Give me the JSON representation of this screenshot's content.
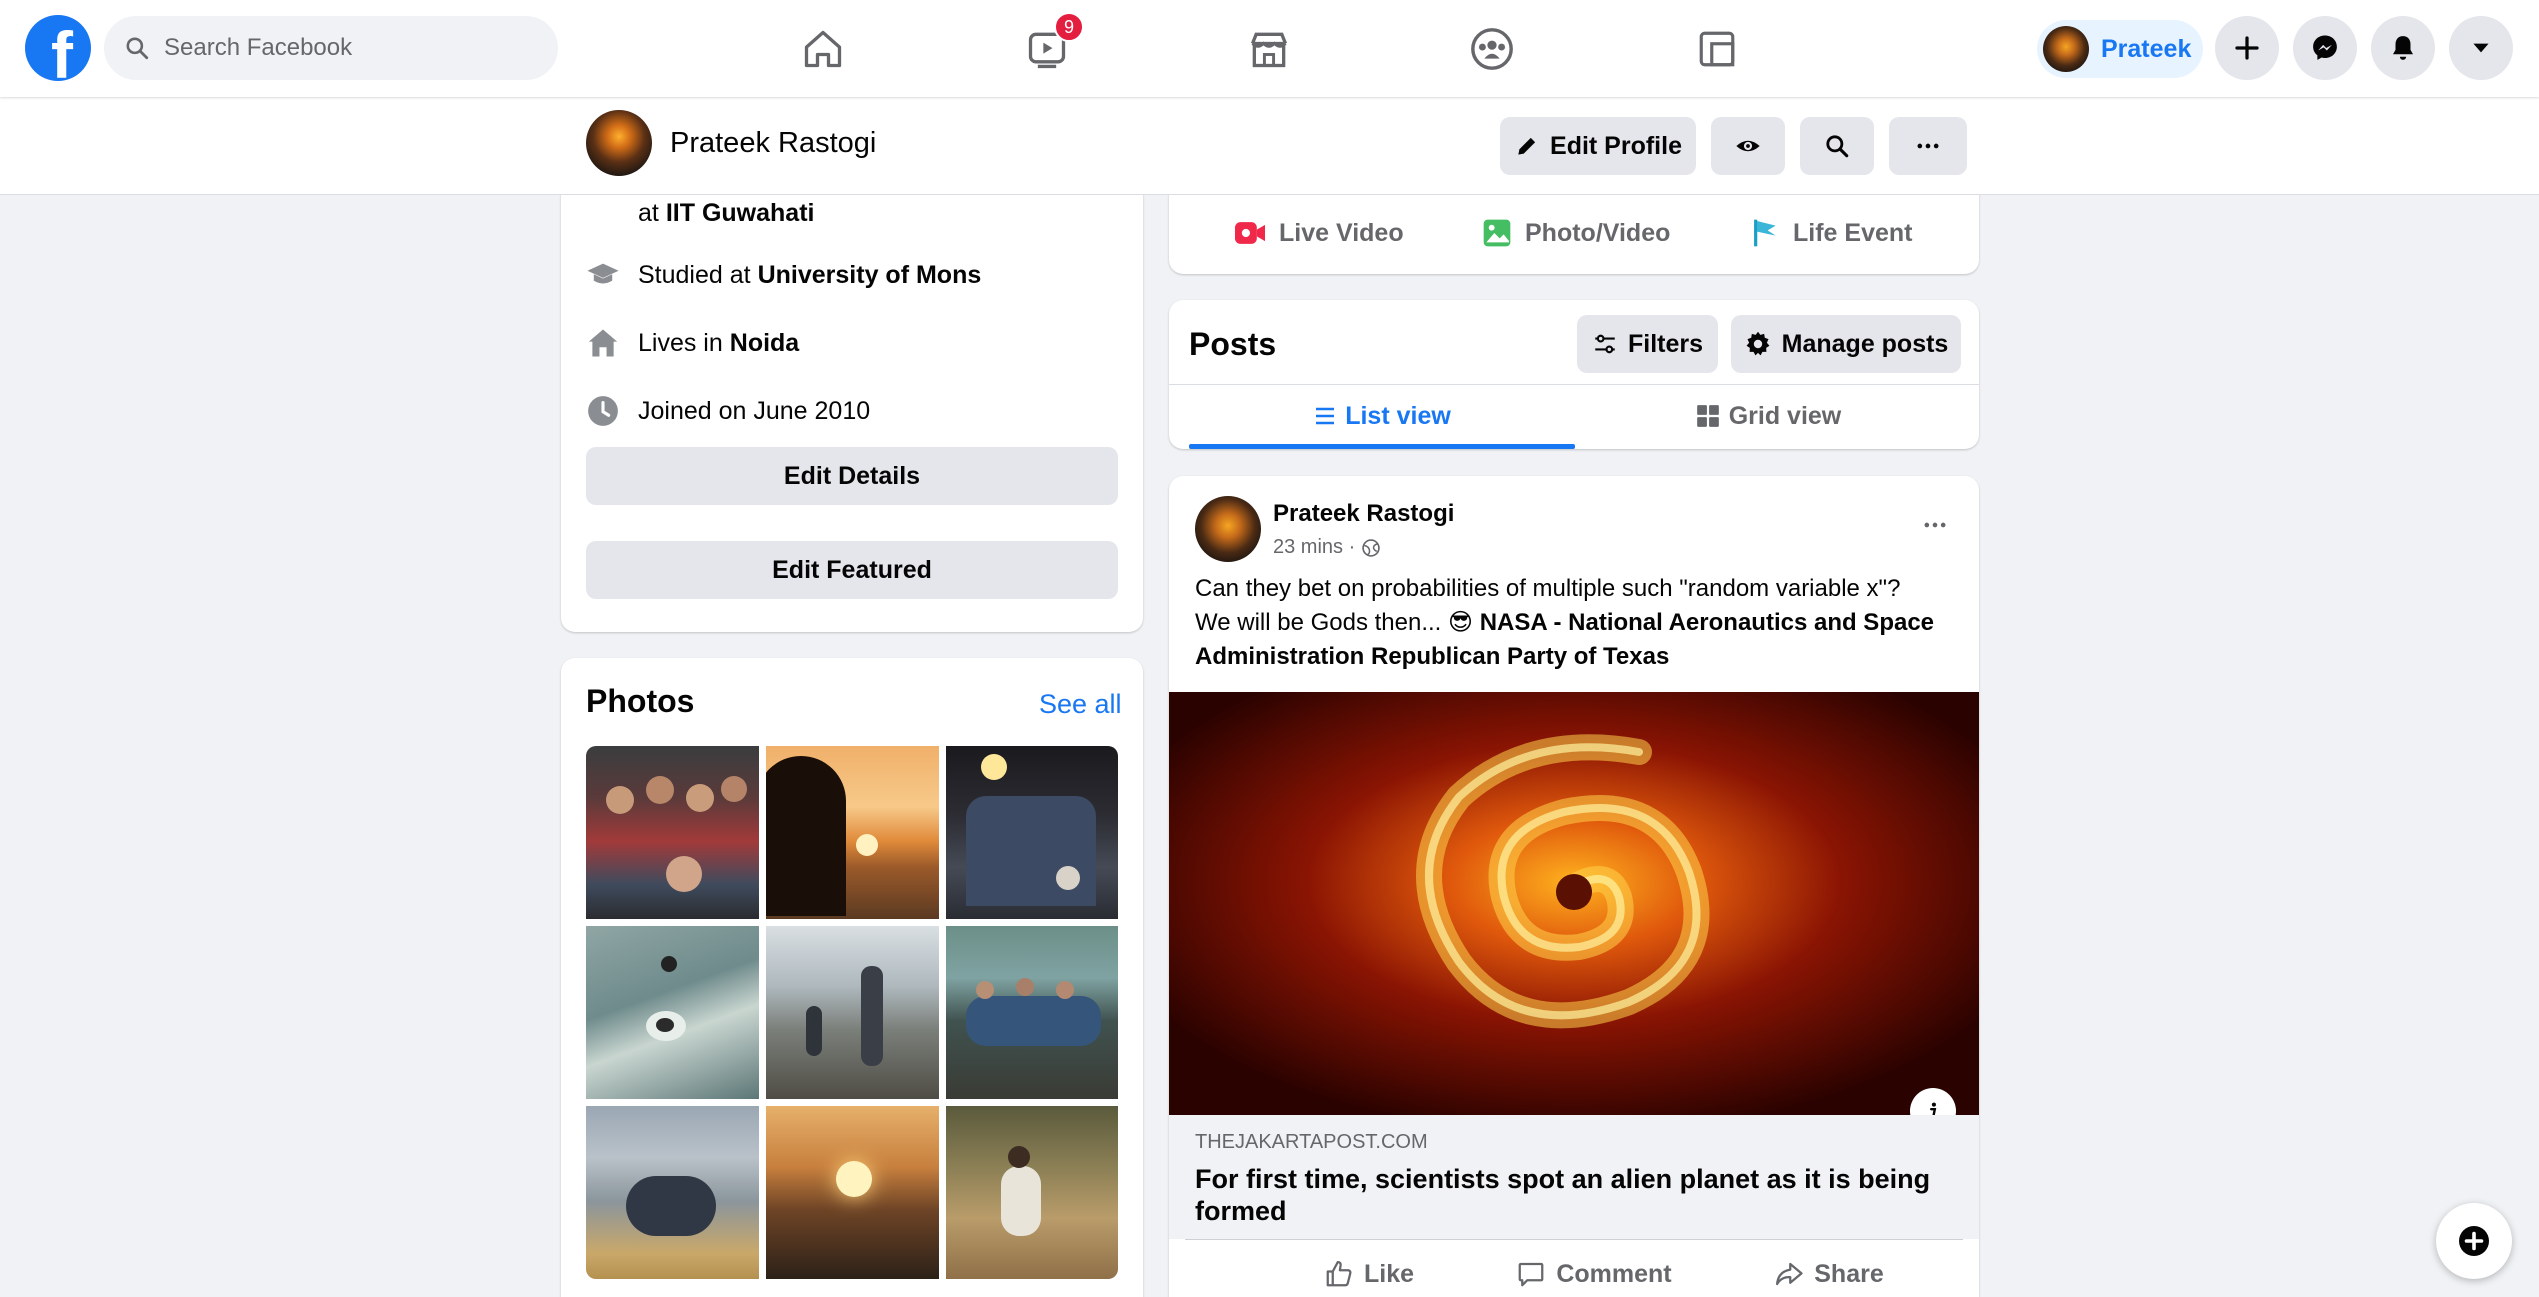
{
  "topnav": {
    "logo": "f",
    "search_placeholder": "Search Facebook",
    "icons": [
      "home-icon",
      "watch-icon",
      "marketplace-icon",
      "groups-icon",
      "gaming-icon"
    ],
    "watch_badge": "9",
    "profile_name": "Prateek",
    "right_icons": [
      "plus-icon",
      "messenger-icon",
      "notifications-icon",
      "account-menu-icon"
    ]
  },
  "profile_bar": {
    "name": "Prateek Rastogi",
    "edit_profile_label": "Edit Profile"
  },
  "intro": {
    "work_prefix": "at",
    "work_place": "IIT Guwahati",
    "studied_prefix": "Studied at",
    "studied_place": "University of Mons",
    "lives_prefix": "Lives in",
    "lives_place": "Noida",
    "joined": "Joined on June 2010",
    "edit_details_label": "Edit Details",
    "edit_featured_label": "Edit Featured"
  },
  "photos": {
    "title": "Photos",
    "see_all_label": "See all"
  },
  "composer": {
    "live_video_label": "Live Video",
    "photo_video_label": "Photo/Video",
    "life_event_label": "Life Event"
  },
  "posts_section": {
    "title": "Posts",
    "filters_label": "Filters",
    "manage_posts_label": "Manage posts",
    "list_view_label": "List view",
    "grid_view_label": "Grid view"
  },
  "post": {
    "author": "Prateek Rastogi",
    "time": "23 mins ·",
    "text_line1": "Can they bet on probabilities of multiple such \"random variable x\"?",
    "text_line2_prefix": "We will be Gods then... 😎",
    "tag_nasa": "NASA - National Aeronautics and Space",
    "tag_line3": "Administration Republican Party of Texas",
    "link_domain": "THEJAKARTAPOST.COM",
    "link_title": "For first time, scientists spot an alien planet as it is being formed",
    "like_label": "Like",
    "comment_label": "Comment",
    "share_label": "Share"
  },
  "colors": {
    "brand_blue": "#1877f2",
    "background": "#f0f2f5",
    "badge_red": "#e41e3f"
  }
}
